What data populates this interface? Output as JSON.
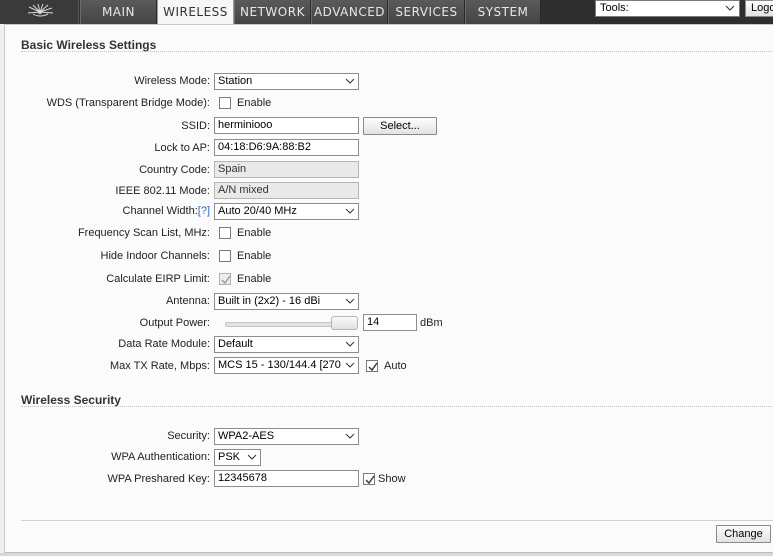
{
  "nav": {
    "tabs": [
      {
        "label": "MAIN"
      },
      {
        "label": "WIRELESS"
      },
      {
        "label": "NETWORK"
      },
      {
        "label": "ADVANCED"
      },
      {
        "label": "SERVICES"
      },
      {
        "label": "SYSTEM"
      }
    ],
    "active_tab": "WIRELESS",
    "tools_select": "Tools:",
    "logout_label": "Logo"
  },
  "basic": {
    "title": "Basic Wireless Settings",
    "wireless_mode": {
      "label": "Wireless Mode:",
      "value": "Station"
    },
    "wds": {
      "label": "WDS (Transparent Bridge Mode):",
      "checkbox_label": "Enable",
      "checked": false
    },
    "ssid": {
      "label": "SSID:",
      "value": "herminiooo",
      "button": "Select..."
    },
    "lock_to_ap": {
      "label": "Lock to AP:",
      "value": "04:18:D6:9A:88:B2"
    },
    "country_code": {
      "label": "Country Code:",
      "value": "Spain"
    },
    "ieee_mode": {
      "label": "IEEE 802.11 Mode:",
      "value": "A/N mixed"
    },
    "channel_width": {
      "label": "Channel Width:",
      "help": "[?]",
      "value": "Auto 20/40 MHz"
    },
    "freq_scan": {
      "label": "Frequency Scan List, MHz:",
      "checkbox_label": "Enable",
      "checked": false
    },
    "hide_indoor": {
      "label": "Hide Indoor Channels:",
      "checkbox_label": "Enable",
      "checked": false
    },
    "eirp": {
      "label": "Calculate EIRP Limit:",
      "checkbox_label": "Enable",
      "checked": true,
      "disabled": true
    },
    "antenna": {
      "label": "Antenna:",
      "value": "Built in (2x2) - 16 dBi"
    },
    "output_power": {
      "label": "Output Power:",
      "value": "14",
      "unit": "dBm",
      "slider_level": 1.0
    },
    "data_rate_module": {
      "label": "Data Rate Module:",
      "value": "Default"
    },
    "max_tx_rate": {
      "label": "Max TX Rate, Mbps:",
      "value": "MCS 15 - 130/144.4 [270",
      "auto_label": "Auto",
      "auto_checked": true
    }
  },
  "security": {
    "title": "Wireless Security",
    "security": {
      "label": "Security:",
      "value": "WPA2-AES"
    },
    "wpa_auth": {
      "label": "WPA Authentication:",
      "value": "PSK"
    },
    "wpa_key": {
      "label": "WPA Preshared Key:",
      "value": "12345678",
      "show_label": "Show",
      "show_checked": true
    }
  },
  "footer": {
    "change_label": "Change"
  },
  "colors": {
    "topbar": "#2e2e2e",
    "tab": "#4f4f4f",
    "active_tab": "#f6f6f6",
    "panel": "#fbfbfb",
    "link": "#2a6ec4"
  }
}
